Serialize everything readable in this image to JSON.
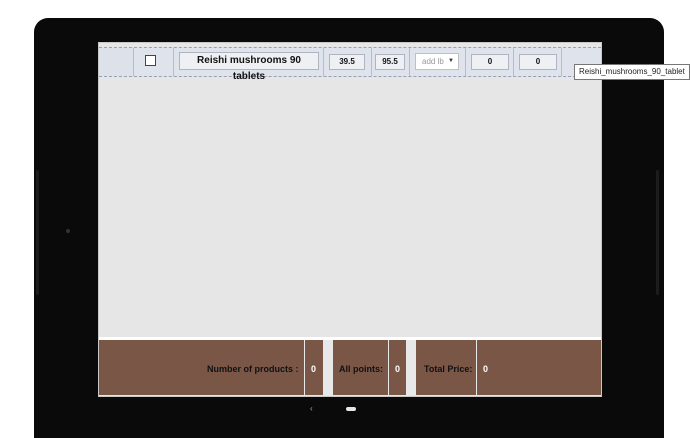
{
  "product": {
    "name": "Reishi mushrooms 90 tablets",
    "value_a": "39.5",
    "value_b": "95.5",
    "select_value": "add lb",
    "qty_a": "0",
    "qty_b": "0",
    "tooltip": "Reishi_mushrooms_90_tablet"
  },
  "footer": {
    "products_label": "Number of products :",
    "products_value": "0",
    "points_label": "All points:",
    "points_value": "0",
    "price_label": "Total Price:",
    "price_value": "0"
  },
  "colors": {
    "footer_bg": "#7a5647",
    "row_bg": "#dfe3ec",
    "screen_bg": "#e6e6e6"
  }
}
